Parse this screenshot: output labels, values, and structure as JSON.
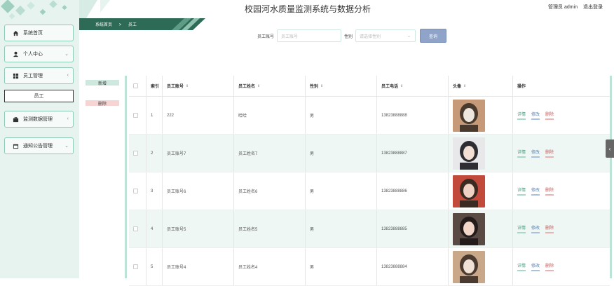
{
  "app": {
    "title": "校园河水质量监测系统与数据分析",
    "user_label": "管理员 admin",
    "logout_label": "退出登录"
  },
  "breadcrumb": {
    "home": "系统首页",
    "separator": ">",
    "current": "员工"
  },
  "sidebar": {
    "items": [
      {
        "label": "系统首页",
        "icon": "home-icon"
      },
      {
        "label": "个人中心",
        "icon": "user-icon"
      },
      {
        "label": "员工管理",
        "icon": "grid-icon"
      },
      {
        "label": "员工",
        "icon": ""
      },
      {
        "label": "监测数据管理",
        "icon": "briefcase-icon"
      },
      {
        "label": "通知公告管理",
        "icon": "calendar-icon"
      }
    ]
  },
  "search": {
    "account_label": "员工账号",
    "account_placeholder": "员工账号",
    "gender_label": "性别",
    "gender_placeholder": "请选择性别",
    "query_label": "查询"
  },
  "actions": {
    "add_label": "新增",
    "delete_label": "删除"
  },
  "table": {
    "headers": [
      "",
      "索引",
      "员工账号",
      "员工姓名",
      "性别",
      "员工电话",
      "头像",
      "操作"
    ],
    "op_labels": {
      "detail": "详情",
      "edit": "修改",
      "delete": "删除"
    },
    "rows": [
      {
        "index": "1",
        "account": "222",
        "name": "哈哈",
        "gender": "男",
        "phone": "13823888888"
      },
      {
        "index": "2",
        "account": "员工账号7",
        "name": "员工姓名7",
        "gender": "男",
        "phone": "13823888887"
      },
      {
        "index": "3",
        "account": "员工账号6",
        "name": "员工姓名6",
        "gender": "男",
        "phone": "13823888886"
      },
      {
        "index": "4",
        "account": "员工账号5",
        "name": "员工姓名5",
        "gender": "男",
        "phone": "13823888885"
      },
      {
        "index": "5",
        "account": "员工账号4",
        "name": "员工姓名4",
        "gender": "男",
        "phone": "13823888884"
      }
    ]
  },
  "colors": {
    "sidebar_bg": "#e6f3ee",
    "accent": "#2e6b57",
    "row_alt": "#eef7f4",
    "query_button": "#8fa4c8"
  }
}
